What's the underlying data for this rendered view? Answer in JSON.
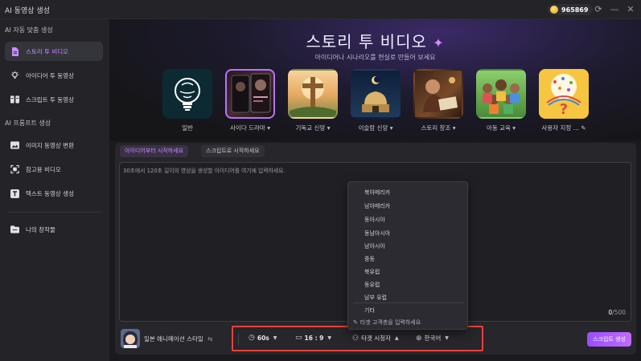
{
  "app": {
    "title": "AI 동영상 생성",
    "credits": "965869"
  },
  "sidebar": {
    "section1": "AI 자동 맞춤 생성",
    "items1": [
      {
        "label": "스토리 투 비디오",
        "icon": "document-icon",
        "active": true
      },
      {
        "label": "아이디어 투 동영상",
        "icon": "lightbulb-icon",
        "active": false
      },
      {
        "label": "스크립트 투 동영상",
        "icon": "script-icon",
        "active": false
      }
    ],
    "section2": "AI 프롬프트 생성",
    "items2": [
      {
        "label": "이미지 동영상 변환",
        "icon": "image-icon"
      },
      {
        "label": "참고용 비디오",
        "icon": "reference-video-icon"
      },
      {
        "label": "텍스트 동영상 생성",
        "icon": "text-icon"
      }
    ],
    "my_works": "나의 창작물"
  },
  "hero": {
    "title": "스토리 투 비디오",
    "subtitle": "아이디어나 시나리오를 현실로 만들어 보세요"
  },
  "categories": [
    {
      "label": "일반",
      "has_caret": false,
      "selected": false
    },
    {
      "label": "사이다 드라마",
      "has_caret": true,
      "selected": true
    },
    {
      "label": "기독교 신앙",
      "has_caret": true,
      "selected": false
    },
    {
      "label": "이슬람 신앙",
      "has_caret": true,
      "selected": false
    },
    {
      "label": "스토리 창조",
      "has_caret": true,
      "selected": false
    },
    {
      "label": "아동 교육",
      "has_caret": true,
      "selected": false
    },
    {
      "label": "사용자 지정 ...",
      "has_caret": false,
      "selected": false
    }
  ],
  "panel": {
    "tabs": [
      "아이디어부터 시작하세요",
      "스크립트로 시작하세요"
    ],
    "placeholder": "30초에서 120초 길이의 영상을 생성할 아이디어를 여기에 입력하세요.",
    "counter_current": "0",
    "counter_max": "/500"
  },
  "bottom": {
    "style_label": "일본 애니메이션 스타일",
    "duration": "60s",
    "ratio": "16 : 9",
    "audience": "타겟 시청자",
    "language": "한국어",
    "generate": "스크립트 생성"
  },
  "dropdown": {
    "items": [
      "북아메리카",
      "남아메리카",
      "동아시아",
      "동남아시아",
      "남아시아",
      "중동",
      "북유럽",
      "동유럽",
      "남부 유럽",
      "기타"
    ],
    "custom": "타겟 고객층을 입력하세요"
  },
  "colors": {
    "accent": "#b574ff",
    "highlight": "#e8413a",
    "background": "#1b1b1f"
  }
}
